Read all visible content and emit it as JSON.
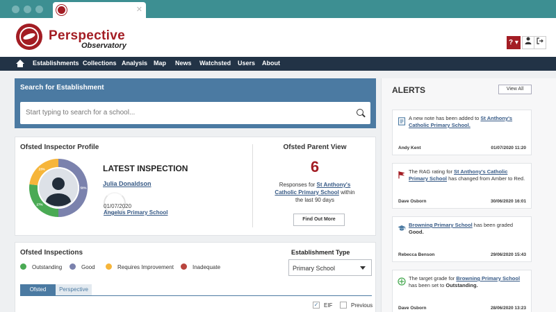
{
  "header": {
    "brand_title": "Perspective",
    "brand_subtitle": "Observatory",
    "help_label": "? ▾"
  },
  "nav": {
    "items": [
      "Establishments",
      "Collections",
      "Analysis",
      "Map",
      "News",
      "Watchsted",
      "Users",
      "About"
    ]
  },
  "search": {
    "title": "Search for Establishment",
    "placeholder": "Start typing to search for a school..."
  },
  "profile": {
    "title": "Ofsted Inspector Profile",
    "latest_title": "LATEST INSPECTION",
    "inspector_name": "Julia Donaldson",
    "inspection_date": "01/07/2020",
    "inspection_school": "Angelus Primary School",
    "donut": [
      {
        "label": "Good",
        "value": 50,
        "display": "50%",
        "color": "#7b82ad"
      },
      {
        "label": "Outstanding",
        "value": 27,
        "display": "27%",
        "color": "#4aaa54"
      },
      {
        "label": "Requires Improvement",
        "value": 23,
        "display": "23%",
        "color": "#f6b53a"
      }
    ]
  },
  "parent_view": {
    "title": "Ofsted Parent View",
    "count": "6",
    "text_before": "Responses for ",
    "school": "St Anthony's Catholic Primary School",
    "text_after": " within the last 90 days",
    "button": "Find Out More"
  },
  "inspections": {
    "title": "Ofsted Inspections",
    "legend": [
      {
        "label": "Outstanding",
        "color": "#4aaa54"
      },
      {
        "label": "Good",
        "color": "#7b82ad"
      },
      {
        "label": "Requires Improvement",
        "color": "#f6b53a"
      },
      {
        "label": "Inadequate",
        "color": "#b9453f"
      }
    ],
    "establishment_type_label": "Establishment Type",
    "establishment_type_value": "Primary School",
    "tabs": [
      "Ofsted",
      "Perspective"
    ],
    "checkbox_eif": "EIF",
    "checkbox_previous": "Previous"
  },
  "alerts": {
    "title": "ALERTS",
    "view_all": "View All",
    "items": [
      {
        "icon": "note-icon",
        "pre": "A new note has been added to ",
        "link": "St Anthony's Catholic Primary School.",
        "post": "",
        "user": "Andy Kent",
        "time": "01/07/2020 11:20"
      },
      {
        "icon": "flag-icon",
        "pre": "The RAG rating for ",
        "link": "St Anthony's Catholic Primary School",
        "post": " has changed from Amber to Red.",
        "user": "Dave Osborn",
        "time": "30/06/2020 16:01"
      },
      {
        "icon": "graduation-cap-icon",
        "pre": "",
        "link": "Browning Primary School",
        "post": " has been graded ",
        "bold": "Good.",
        "user": "Rebecca Benson",
        "time": "29/06/2020 15:43"
      },
      {
        "icon": "target-icon",
        "pre": "The target grade for ",
        "link": "Browning Primary School",
        "post": " has been set to ",
        "bold": "Outstanding.",
        "user": "Dave Osborn",
        "time": "28/06/2020 13:23"
      }
    ]
  }
}
